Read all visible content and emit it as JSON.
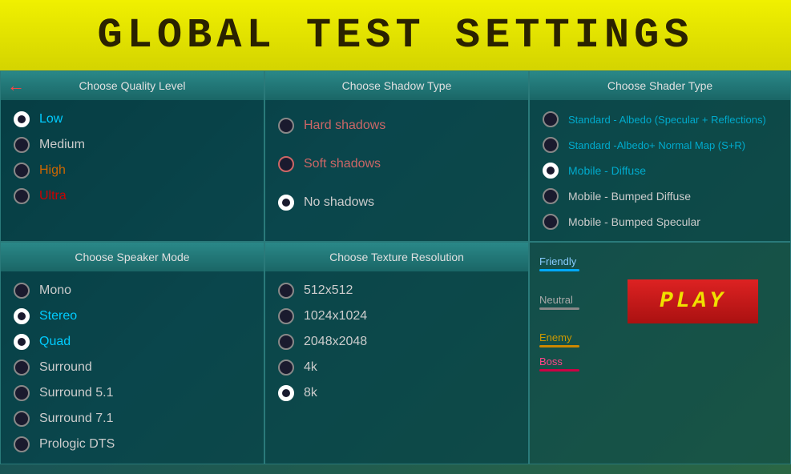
{
  "title": "GLOBAL TEST SETTINGS",
  "panels": {
    "quality": {
      "header": "Choose Quality Level",
      "options": [
        {
          "id": "low",
          "label": "Low",
          "colorClass": "color-low",
          "selected": true
        },
        {
          "id": "medium",
          "label": "Medium",
          "colorClass": "color-medium",
          "selected": false
        },
        {
          "id": "high",
          "label": "High",
          "colorClass": "color-high",
          "selected": false
        },
        {
          "id": "ultra",
          "label": "Ultra",
          "colorClass": "color-ultra",
          "selected": false
        }
      ],
      "hasBackArrow": true
    },
    "shadow": {
      "header": "Choose Shadow Type",
      "options": [
        {
          "id": "hard",
          "label": "Hard shadows",
          "colorClass": "color-hard",
          "selected": false
        },
        {
          "id": "soft",
          "label": "Soft shadows",
          "colorClass": "color-soft",
          "selected": false
        },
        {
          "id": "no",
          "label": "No shadows",
          "colorClass": "color-no",
          "selected": true
        }
      ]
    },
    "shader": {
      "header": "Choose Shader Type",
      "options": [
        {
          "id": "standard-albedo",
          "label": "Standard - Albedo (Specular + Reflections)",
          "colorClass": "color-standard-albedo",
          "selected": false
        },
        {
          "id": "standard-normal",
          "label": "Standard -Albedo+ Normal Map (S+R)",
          "colorClass": "color-standard-normal",
          "selected": false
        },
        {
          "id": "mobile-diffuse",
          "label": "Mobile - Diffuse",
          "colorClass": "color-mobile-diffuse",
          "selected": true
        },
        {
          "id": "mobile-bumped",
          "label": "Mobile - Bumped Diffuse",
          "colorClass": "color-mobile-bumped",
          "selected": false
        },
        {
          "id": "mobile-specular",
          "label": "Mobile - Bumped Specular",
          "colorClass": "color-mobile-specular",
          "selected": false
        }
      ]
    },
    "speaker": {
      "header": "Choose Speaker Mode",
      "options": [
        {
          "id": "mono",
          "label": "Mono",
          "colorClass": "color-mono",
          "selected": false
        },
        {
          "id": "stereo",
          "label": "Stereo",
          "colorClass": "color-stereo",
          "selected": true
        },
        {
          "id": "quad",
          "label": "Quad",
          "colorClass": "color-quad",
          "selected": true
        },
        {
          "id": "surround",
          "label": "Surround",
          "colorClass": "color-surround",
          "selected": false
        },
        {
          "id": "surround51",
          "label": "Surround 5.1",
          "colorClass": "color-surround",
          "selected": false
        },
        {
          "id": "surround71",
          "label": "Surround 7.1",
          "colorClass": "color-surround",
          "selected": false
        },
        {
          "id": "prologic",
          "label": "Prologic DTS",
          "colorClass": "color-surround",
          "selected": false
        }
      ]
    },
    "texture": {
      "header": "Choose Texture Resolution",
      "options": [
        {
          "id": "res512",
          "label": "512x512",
          "colorClass": "color-512",
          "selected": false
        },
        {
          "id": "res1024",
          "label": "1024x1024",
          "colorClass": "color-1024",
          "selected": false
        },
        {
          "id": "res2048",
          "label": "2048x2048",
          "colorClass": "color-2048",
          "selected": false
        },
        {
          "id": "res4k",
          "label": "4k",
          "colorClass": "color-4k",
          "selected": false
        },
        {
          "id": "res8k",
          "label": "8k",
          "colorClass": "color-8k",
          "selected": true
        }
      ]
    }
  },
  "teams": [
    {
      "id": "friendly",
      "label": "Friendly",
      "barClass": "bar-friendly",
      "colorClass": "color-friendly"
    },
    {
      "id": "neutral",
      "label": "Neutral",
      "barClass": "bar-neutral",
      "colorClass": "color-neutral"
    },
    {
      "id": "enemy",
      "label": "Enemy",
      "barClass": "bar-enemy",
      "colorClass": "color-enemy"
    },
    {
      "id": "boss",
      "label": "Boss",
      "barClass": "bar-boss",
      "colorClass": "color-boss"
    }
  ],
  "play_button": "PLAY"
}
